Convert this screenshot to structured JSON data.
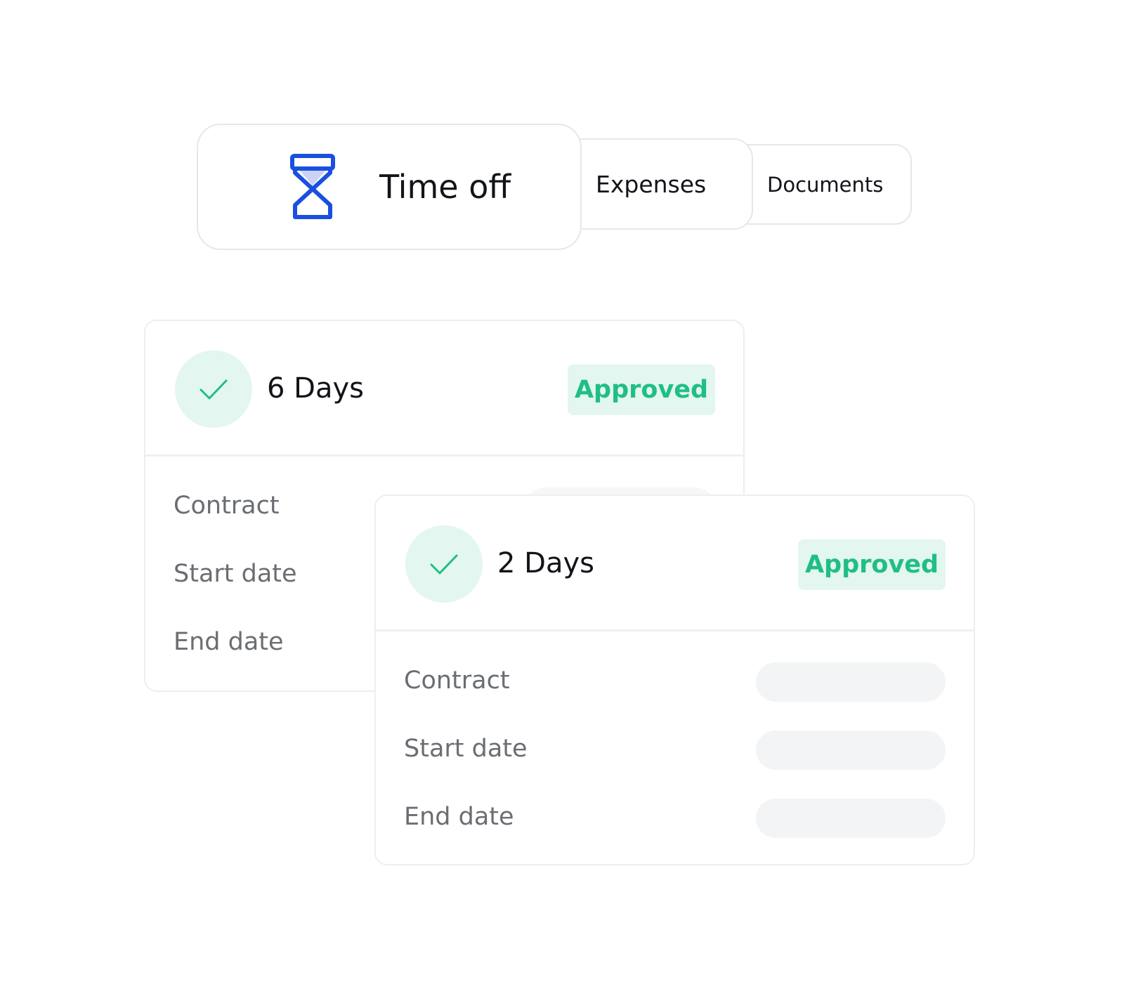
{
  "tabs": {
    "time_off": {
      "label": "Time off",
      "icon": "hourglass-icon",
      "icon_color": "#1a4fe0"
    },
    "expenses": {
      "label": "Expenses"
    },
    "documents": {
      "label": "Documents"
    }
  },
  "cards": [
    {
      "days": "6 Days",
      "status": "Approved",
      "status_color": "#1fbf83",
      "rows": [
        {
          "label": "Contract"
        },
        {
          "label": "Start date"
        },
        {
          "label": "End date"
        }
      ]
    },
    {
      "days": "2 Days",
      "status": "Approved",
      "status_color": "#1fbf83",
      "rows": [
        {
          "label": "Contract"
        },
        {
          "label": "Start date"
        },
        {
          "label": "End date"
        }
      ]
    }
  ]
}
